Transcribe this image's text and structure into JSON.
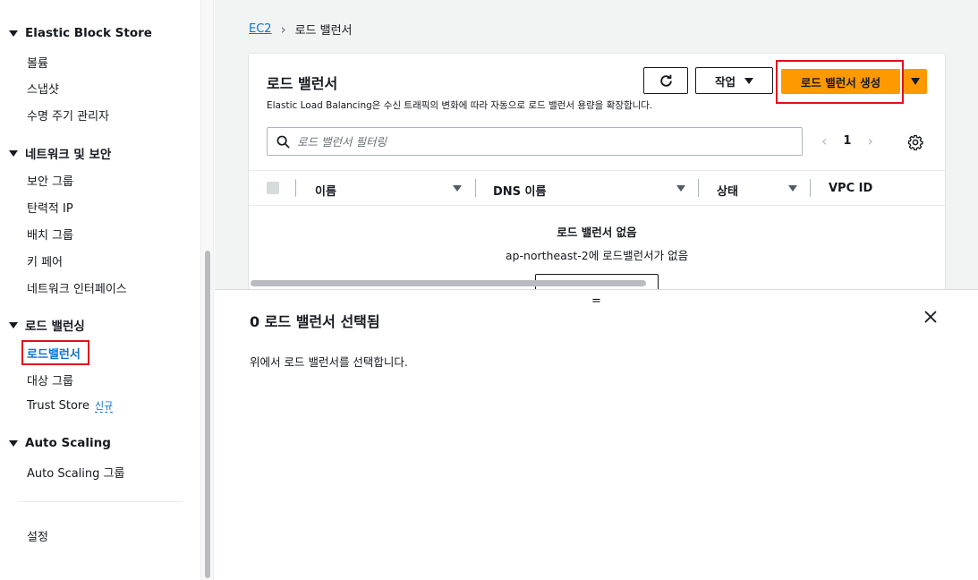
{
  "sidebar": {
    "sections": [
      {
        "title": "Elastic Block Store",
        "items": [
          "볼륨",
          "스냅샷",
          "수명 주기 관리자"
        ]
      },
      {
        "title": "네트워크 및 보안",
        "items": [
          "보안 그룹",
          "탄력적 IP",
          "배치 그룹",
          "키 페어",
          "네트워크 인터페이스"
        ]
      },
      {
        "title": "로드 밸런싱",
        "items": [
          "로드밸런서",
          "대상 그룹",
          "Trust Store"
        ]
      },
      {
        "title": "Auto Scaling",
        "items": [
          "Auto Scaling 그룹"
        ]
      }
    ],
    "new_badge": "신규",
    "settings": "설정",
    "active_item": "로드밸런서"
  },
  "breadcrumb": {
    "root": "EC2",
    "current": "로드 밸런서"
  },
  "panel": {
    "title": "로드 밸런서",
    "description": "Elastic Load Balancing은 수신 트래픽의 변화에 따라 자동으로 로드 밸런서 용량을 확장합니다.",
    "actions_label": "작업",
    "create_label": "로드 밸런서 생성",
    "filter_placeholder": "로드 밸런서 필터링",
    "page": "1",
    "columns": [
      "이름",
      "DNS 이름",
      "상태",
      "VPC ID"
    ],
    "empty_title": "로드 밸런서 없음",
    "empty_sub": "ap-northeast-2에 로드밸런서가 없음"
  },
  "split_panel": {
    "handle": "=",
    "title": "0 로드 밸런서 선택됨",
    "text": "위에서 로드 밸런서를 선택합니다."
  },
  "colors": {
    "accent": "#0972d3",
    "primary_button": "#ff9900",
    "highlight": "#e0101a"
  }
}
